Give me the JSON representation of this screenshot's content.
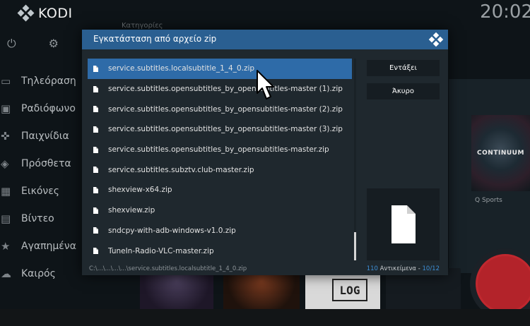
{
  "app": {
    "name": "KODI",
    "clock": "20:02",
    "breadcrumb": "Κατηγορίες"
  },
  "top_icons": [
    "power-icon",
    "gear-icon"
  ],
  "sidebar": {
    "items": [
      {
        "icon": "tv-icon",
        "label": "Τηλεόραση"
      },
      {
        "icon": "radio-icon",
        "label": "Ραδιόφωνο"
      },
      {
        "icon": "gamepad-icon",
        "label": "Παιχνίδια"
      },
      {
        "icon": "addons-icon",
        "label": "Πρόσθετα"
      },
      {
        "icon": "pictures-icon",
        "label": "Εικόνες"
      },
      {
        "icon": "video-icon",
        "label": "Βίντεο"
      },
      {
        "icon": "star-icon",
        "label": "Αγαπημένα"
      },
      {
        "icon": "weather-icon",
        "label": "Καιρός"
      }
    ]
  },
  "background_tiles": {
    "qsports_label": "Q Sports",
    "continuum_text": "CONTINUUM",
    "log_text": "LOG"
  },
  "dialog": {
    "title": "Εγκατάσταση από αρχείο zip",
    "files": [
      "service.subtitles.localsubtitle_1_4_0.zip",
      "service.subtitles.opensubtitles_by_opensubtitles-master (1).zip",
      "service.subtitles.opensubtitles_by_opensubtitles-master (2).zip",
      "service.subtitles.opensubtitles_by_opensubtitles-master (3).zip",
      "service.subtitles.opensubtitles_by_opensubtitles-master.zip",
      "service.subtitles.subztv.club-master.zip",
      "shexview-x64.zip",
      "shexview.zip",
      "sndcpy-with-adb-windows-v1.0.zip",
      "TuneIn-Radio-VLC-master.zip"
    ],
    "selected_index": 0,
    "ok_label": "Εντάξει",
    "cancel_label": "Άκυρο",
    "path": "C:\\...\\...\\...\\...\\service.subtitles.localsubtitle_1_4_0.zip",
    "count_num": "110",
    "count_label": "Αντικείμενα - ",
    "count_pos": "10/12"
  },
  "colors": {
    "header": "#2a5f91",
    "selected": "#2e6ba8",
    "accent": "#3e8fd6"
  }
}
